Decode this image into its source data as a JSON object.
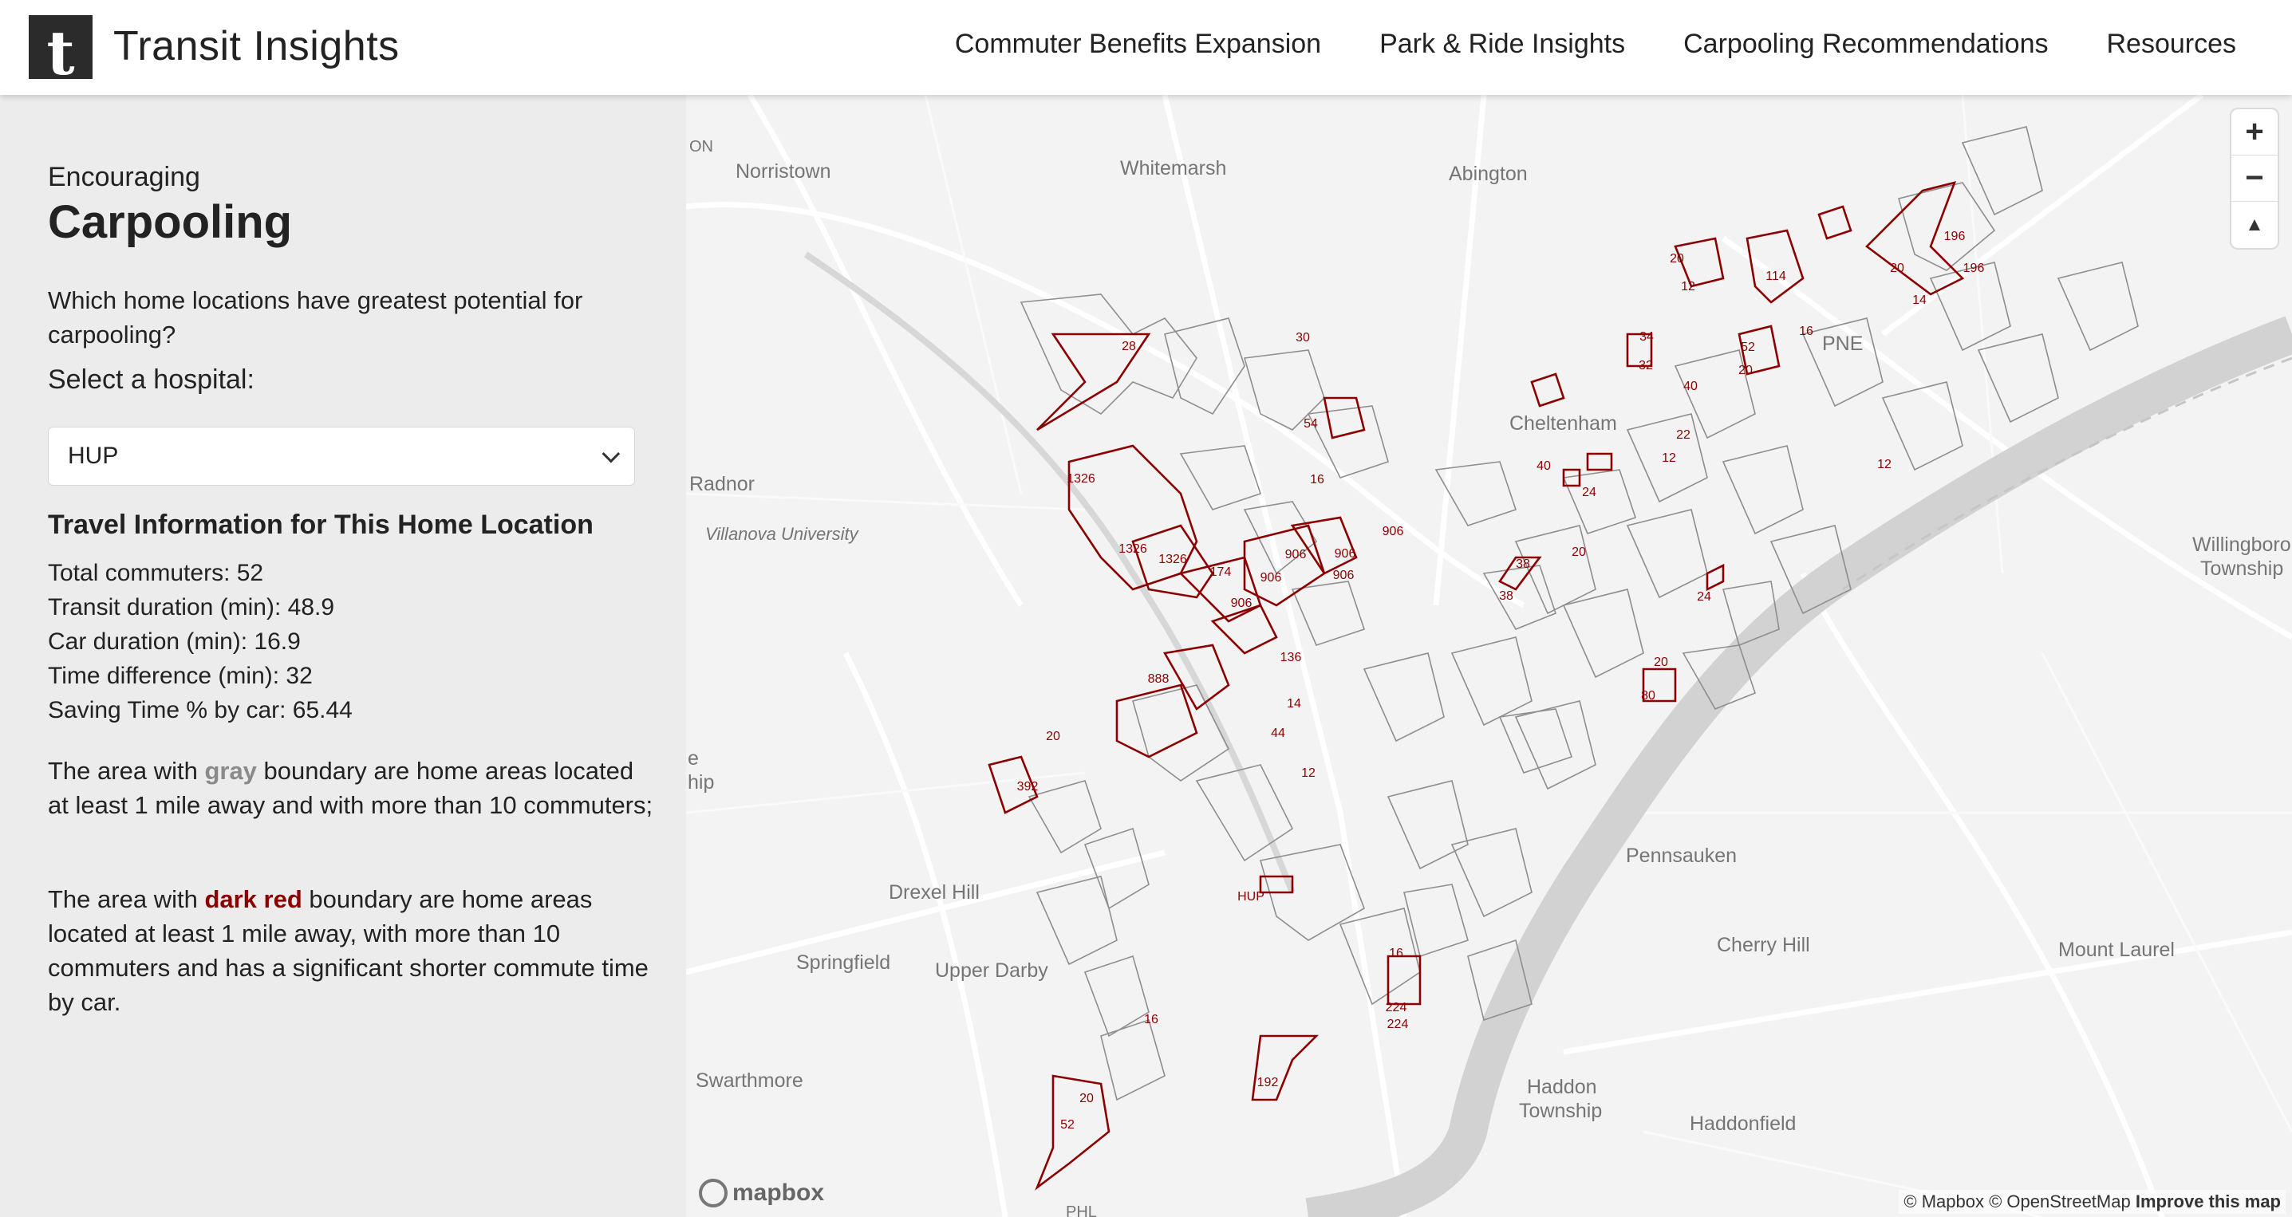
{
  "header": {
    "logo_letter": "t",
    "title": "Transit Insights",
    "nav": [
      "Commuter Benefits Expansion",
      "Park & Ride Insights",
      "Carpooling Recommendations",
      "Resources"
    ]
  },
  "sidebar": {
    "eyebrow": "Encouraging",
    "title": "Carpooling",
    "question": "Which home locations have greatest potential for carpooling?",
    "select_label": "Select a hospital:",
    "selected_hospital": "HUP",
    "info_title": "Travel Information for This Home Location",
    "info": [
      "Total commuters: 52",
      "Transit duration (min): 48.9",
      "Car duration (min): 16.9",
      "Time difference (min): 32",
      "Saving Time % by car: 65.44"
    ],
    "desc1_pre": "The area with ",
    "desc1_word": "gray",
    "desc1_post": " boundary are home areas located at least 1 mile away and with more than 10 commuters;",
    "desc2_pre": "The area with ",
    "desc2_word": "dark red",
    "desc2_post": " boundary are home areas located at least 1 mile away, with more than 10 commuters and has a significant shorter commute time by car."
  },
  "map": {
    "places": [
      "ON",
      "Norristown",
      "Whitemarsh",
      "Abington",
      "Radnor",
      "Villanova University",
      "Cheltenham",
      "PNE",
      "Willingboro",
      "Township",
      "e",
      "hip",
      "Drexel Hill",
      "Springfield",
      "Upper Darby",
      "Pennsauken",
      "Cherry Hill",
      "Mount Laurel",
      "Swarthmore",
      "Haddon",
      "Township",
      "Haddonfield",
      "PHL"
    ],
    "polygon_labels": [
      "28",
      "30",
      "54",
      "16",
      "1326",
      "1326",
      "1326",
      "174",
      "906",
      "906",
      "906",
      "906",
      "906",
      "906",
      "136",
      "888",
      "20",
      "392",
      "14",
      "44",
      "12",
      "HUP",
      "16",
      "224",
      "224",
      "192",
      "20",
      "52",
      "16",
      "20",
      "12",
      "114",
      "16",
      "52",
      "20",
      "34",
      "32",
      "40",
      "22",
      "12",
      "40",
      "24",
      "20",
      "38",
      "38",
      "24",
      "20",
      "80",
      "196",
      "196",
      "20",
      "14",
      "12"
    ],
    "zoom_in": "+",
    "zoom_out": "−",
    "compass": "▲",
    "mapbox_logo": "mapbox",
    "attribution": "© Mapbox © OpenStreetMap",
    "improve": "Improve this map",
    "colors": {
      "gray_boundary": "#8a8a8a",
      "red_boundary": "#8b0000",
      "river": "#d4d4d4"
    }
  }
}
